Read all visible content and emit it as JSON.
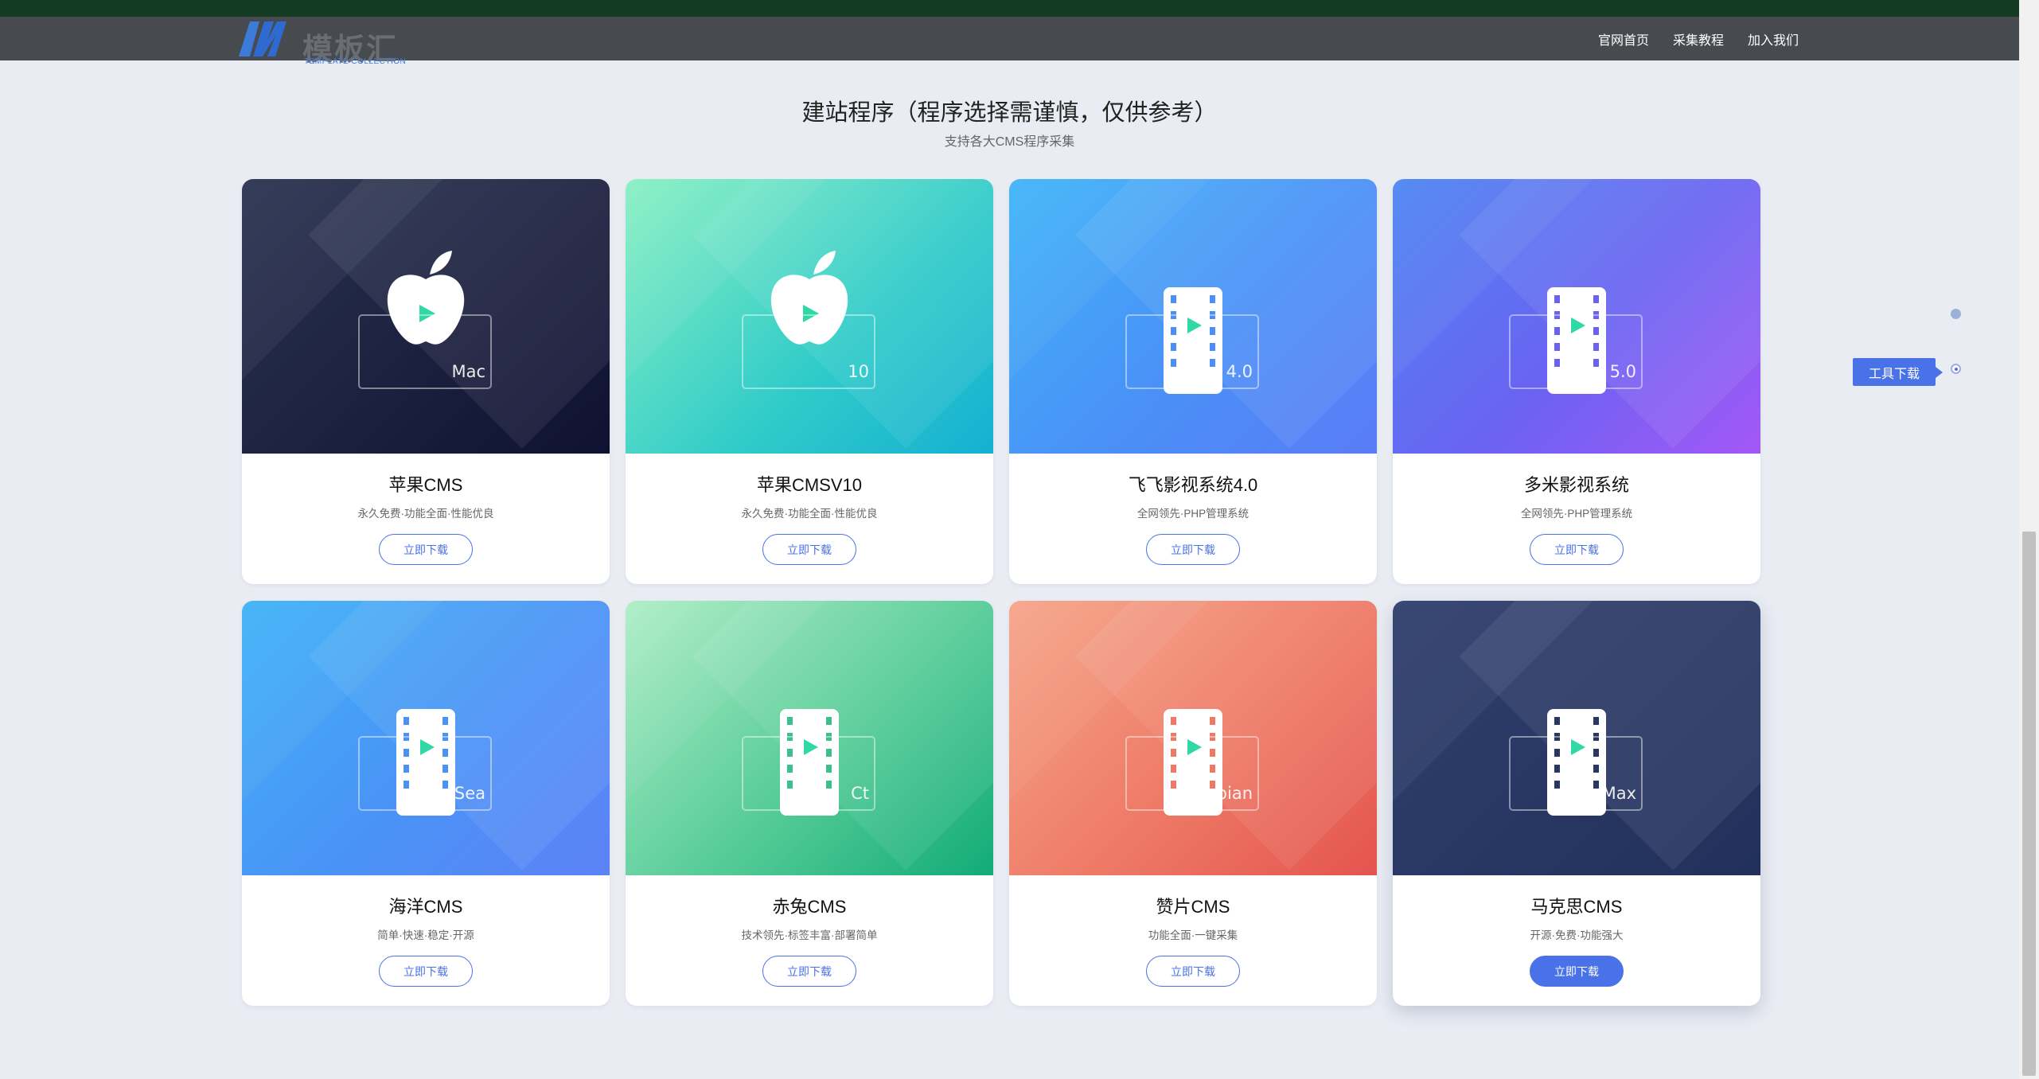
{
  "header": {
    "logo_text": "模板汇",
    "logo_subtitle": "TEMPLATE COLLECTION",
    "nav": [
      "官网首页",
      "采集教程",
      "加入我们"
    ]
  },
  "section": {
    "title": "建站程序（程序选择需谨慎，仅供参考）",
    "subtitle": "支持各大CMS程序采集"
  },
  "cards": [
    {
      "name": "苹果CMS",
      "desc": "永久免费·功能全面·性能优良",
      "button": "立即下载",
      "badge": "Mac",
      "icon": "apple-play-icon",
      "gradient": "g-dark",
      "accent": "#5b6b9a"
    },
    {
      "name": "苹果CMSV10",
      "desc": "永久免费·功能全面·性能优良",
      "button": "立即下载",
      "badge": "10",
      "icon": "apple-play-icon",
      "gradient": "g-mint",
      "accent": "#3fd0c2"
    },
    {
      "name": "飞飞影视系统4.0",
      "desc": "全网领先·PHP管理系统",
      "button": "立即下载",
      "badge": "4.0",
      "icon": "film-play-icon",
      "gradient": "g-blue",
      "accent": "#4b8ef7"
    },
    {
      "name": "多米影视系统",
      "desc": "全网领先·PHP管理系统",
      "button": "立即下载",
      "badge": "5.0",
      "icon": "film-play-icon",
      "gradient": "g-purp",
      "accent": "#6a63f2"
    },
    {
      "name": "海洋CMS",
      "desc": "简单·快速·稳定·开源",
      "button": "立即下载",
      "badge": "Sea",
      "icon": "film-play-icon",
      "gradient": "g-sea",
      "accent": "#4a93f6"
    },
    {
      "name": "赤兔CMS",
      "desc": "技术领先·标签丰富·部署简单",
      "button": "立即下载",
      "badge": "Ct",
      "icon": "film-play-icon",
      "gradient": "g-green",
      "accent": "#3cc08b"
    },
    {
      "name": "赞片CMS",
      "desc": "功能全面·一键采集",
      "button": "立即下载",
      "badge": "zanpian",
      "icon": "film-play-icon",
      "gradient": "g-coral",
      "accent": "#ee7a66"
    },
    {
      "name": "马克思CMS",
      "desc": "开源·免费·功能强大",
      "button": "立即下载",
      "badge": "Max",
      "icon": "film-play-icon",
      "gradient": "g-navy",
      "accent": "#2a3763",
      "active": true
    }
  ],
  "side": {
    "tooltip": "工具下载"
  },
  "colors": {
    "accent": "#4a72e8",
    "navbar": "#474a4f",
    "page_bg": "#e9ecf3",
    "play": "#2fd8a4"
  }
}
